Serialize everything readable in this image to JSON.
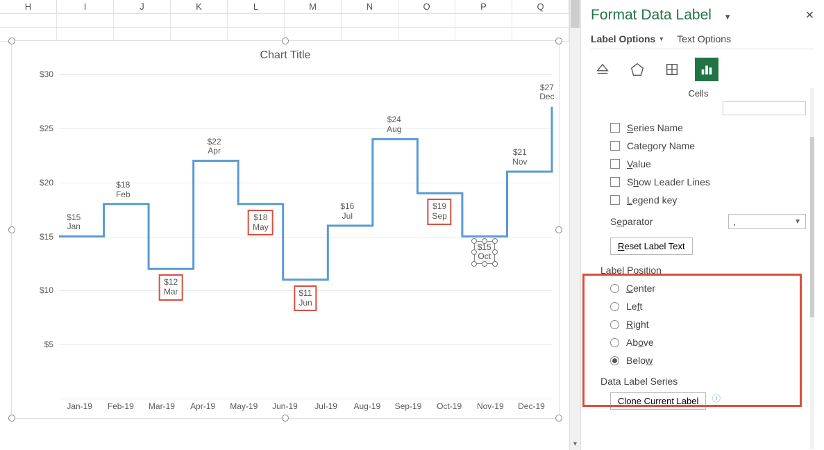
{
  "columns": [
    "H",
    "I",
    "J",
    "K",
    "L",
    "M",
    "N",
    "O",
    "P",
    "Q"
  ],
  "chart": {
    "title": "Chart Title",
    "y_ticks": [
      "$30",
      "$25",
      "$20",
      "$15",
      "$10",
      "$5"
    ],
    "x_ticks": [
      "Jan-19",
      "Feb-19",
      "Mar-19",
      "Apr-19",
      "May-19",
      "Jun-19",
      "Jul-19",
      "Aug-19",
      "Sep-19",
      "Oct-19",
      "Nov-19",
      "Dec-19"
    ]
  },
  "chart_data": {
    "type": "line",
    "title": "Chart Title",
    "xlabel": "",
    "ylabel": "",
    "ylim": [
      0,
      30
    ],
    "categories": [
      "Jan",
      "Feb",
      "Mar",
      "Apr",
      "May",
      "Jun",
      "Jul",
      "Aug",
      "Sep",
      "Oct",
      "Nov",
      "Dec"
    ],
    "values": [
      15,
      18,
      12,
      22,
      18,
      11,
      16,
      24,
      19,
      15,
      21,
      27
    ],
    "value_labels": [
      "$15",
      "$18",
      "$12",
      "$22",
      "$18",
      "$11",
      "$16",
      "$24",
      "$19",
      "$15",
      "$21",
      "$27"
    ]
  },
  "labels": {
    "jan": {
      "v": "$15",
      "m": "Jan"
    },
    "feb": {
      "v": "$18",
      "m": "Feb"
    },
    "mar": {
      "v": "$12",
      "m": "Mar"
    },
    "apr": {
      "v": "$22",
      "m": "Apr"
    },
    "may": {
      "v": "$18",
      "m": "May"
    },
    "jun": {
      "v": "$11",
      "m": "Jun"
    },
    "jul": {
      "v": "$16",
      "m": "Jul"
    },
    "aug": {
      "v": "$24",
      "m": "Aug"
    },
    "sep": {
      "v": "$19",
      "m": "Sep"
    },
    "oct": {
      "v": "$15",
      "m": "Oct"
    },
    "nov": {
      "v": "$21",
      "m": "Nov"
    },
    "dec": {
      "v": "$27",
      "m": "Dec"
    }
  },
  "pane": {
    "title": "Format Data Label",
    "tab_label_options": "Label Options",
    "tab_text_options": "Text Options",
    "cells_stub": "Cells",
    "chk_series_name": "Series Name",
    "chk_category_name": "Category Name",
    "chk_value": "Value",
    "chk_leader": "Show Leader Lines",
    "chk_legend_key": "Legend key",
    "separator_label": "Separator",
    "separator_value": ",",
    "reset_btn": "Reset Label Text",
    "label_position_title": "Label Position",
    "pos_center": "Center",
    "pos_left": "Left",
    "pos_right": "Right",
    "pos_above": "Above",
    "pos_below": "Below",
    "data_label_series_title": "Data Label Series",
    "clone_btn": "Clone Current Label"
  }
}
